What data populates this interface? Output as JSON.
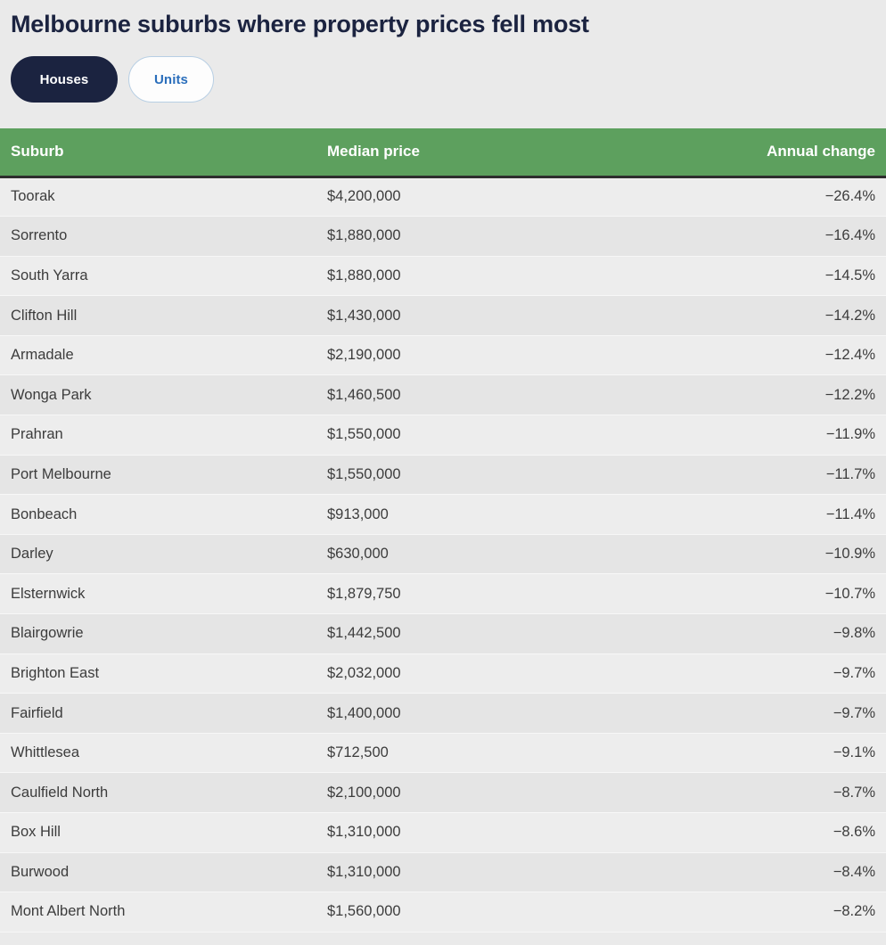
{
  "header": {
    "title": "Melbourne suburbs where property prices fell most"
  },
  "toggle": {
    "options": [
      {
        "label": "Houses",
        "selected": true
      },
      {
        "label": "Units",
        "selected": false
      }
    ],
    "active_color": "#1b2340",
    "inactive_text_color": "#2a6ebb",
    "inactive_border_color": "#b8cfe4"
  },
  "table": {
    "header_bg": "#5da05e",
    "header_text_color": "#ffffff",
    "columns": [
      {
        "key": "suburb",
        "label": "Suburb",
        "align": "left"
      },
      {
        "key": "median_price",
        "label": "Median price",
        "align": "left"
      },
      {
        "key": "annual_change",
        "label": "Annual change",
        "align": "right"
      }
    ],
    "rows": [
      {
        "suburb": "Toorak",
        "median_price": "$4,200,000",
        "annual_change": "−26.4%"
      },
      {
        "suburb": "Sorrento",
        "median_price": "$1,880,000",
        "annual_change": "−16.4%"
      },
      {
        "suburb": "South Yarra",
        "median_price": "$1,880,000",
        "annual_change": "−14.5%"
      },
      {
        "suburb": "Clifton Hill",
        "median_price": "$1,430,000",
        "annual_change": "−14.2%"
      },
      {
        "suburb": "Armadale",
        "median_price": "$2,190,000",
        "annual_change": "−12.4%"
      },
      {
        "suburb": "Wonga Park",
        "median_price": "$1,460,500",
        "annual_change": "−12.2%"
      },
      {
        "suburb": "Prahran",
        "median_price": "$1,550,000",
        "annual_change": "−11.9%"
      },
      {
        "suburb": "Port Melbourne",
        "median_price": "$1,550,000",
        "annual_change": "−11.7%"
      },
      {
        "suburb": "Bonbeach",
        "median_price": "$913,000",
        "annual_change": "−11.4%"
      },
      {
        "suburb": "Darley",
        "median_price": "$630,000",
        "annual_change": "−10.9%"
      },
      {
        "suburb": "Elsternwick",
        "median_price": "$1,879,750",
        "annual_change": "−10.7%"
      },
      {
        "suburb": "Blairgowrie",
        "median_price": "$1,442,500",
        "annual_change": "−9.8%"
      },
      {
        "suburb": "Brighton East",
        "median_price": "$2,032,000",
        "annual_change": "−9.7%"
      },
      {
        "suburb": "Fairfield",
        "median_price": "$1,400,000",
        "annual_change": "−9.7%"
      },
      {
        "suburb": "Whittlesea",
        "median_price": "$712,500",
        "annual_change": "−9.1%"
      },
      {
        "suburb": "Caulfield North",
        "median_price": "$2,100,000",
        "annual_change": "−8.7%"
      },
      {
        "suburb": "Box Hill",
        "median_price": "$1,310,000",
        "annual_change": "−8.6%"
      },
      {
        "suburb": "Burwood",
        "median_price": "$1,310,000",
        "annual_change": "−8.4%"
      },
      {
        "suburb": "Mont Albert North",
        "median_price": "$1,560,000",
        "annual_change": "−8.2%"
      }
    ]
  }
}
